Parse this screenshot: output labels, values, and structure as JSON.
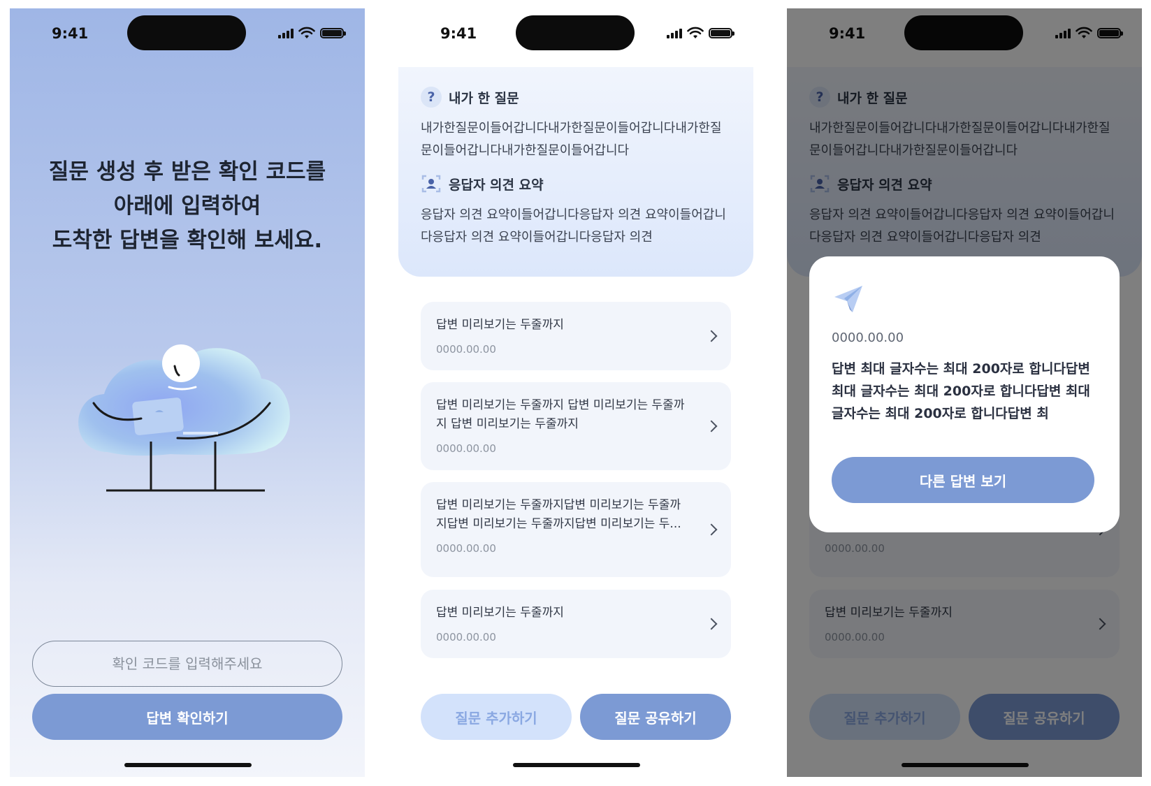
{
  "status": {
    "time": "9:41"
  },
  "screen1": {
    "title_lines": [
      "질문 생성 후 받은 확인 코드를",
      "아래에 입력하여",
      "도착한 답변을 확인해 보세요."
    ],
    "code_placeholder": "확인 코드를 입력해주세요",
    "confirm_label": "답변 확인하기"
  },
  "question_card": {
    "my_question_label": "내가 한 질문",
    "my_question_text": "내가한질문이들어갑니다내가한질문이들어갑니다내가한질문이들어갑니다내가한질문이들어갑니다",
    "summary_label": "응답자 의견 요약",
    "summary_text": "응답자 의견 요약이들어갑니다응답자 의견 요약이들어갑니다응답자 의견 요약이들어갑니다응답자 의견"
  },
  "answers": [
    {
      "preview": "답변 미리보기는 두줄까지",
      "date": "0000.00.00"
    },
    {
      "preview": "답변 미리보기는 두줄까지 답변 미리보기는 두줄까지 답변 미리보기는 두줄까지",
      "date": "0000.00.00"
    },
    {
      "preview": "답변 미리보기는 두줄까지답변 미리보기는 두줄까지답변 미리보기는 두줄까지답변 미리보기는 두...",
      "date": "0000.00.00"
    },
    {
      "preview": "답변 미리보기는 두줄까지",
      "date": "0000.00.00"
    }
  ],
  "actions": {
    "add_label": "질문 추가하기",
    "share_label": "질문 공유하기"
  },
  "modal": {
    "date": "0000.00.00",
    "text": "답변 최대 글자수는 최대 200자로 합니다답변 최대 글자수는 최대 200자로 합니다답변 최대 글자수는 최대 200자로 합니다답변 최",
    "button_label": "다른 답변 보기"
  },
  "colors": {
    "primary": "#7c9ad4",
    "secondary": "#d3e2fb",
    "card": "#f2f5fb"
  },
  "icons": [
    "signal-icon",
    "wifi-icon",
    "battery-icon",
    "question-icon",
    "respondent-icon",
    "chevron-right-icon",
    "paper-plane-icon"
  ]
}
